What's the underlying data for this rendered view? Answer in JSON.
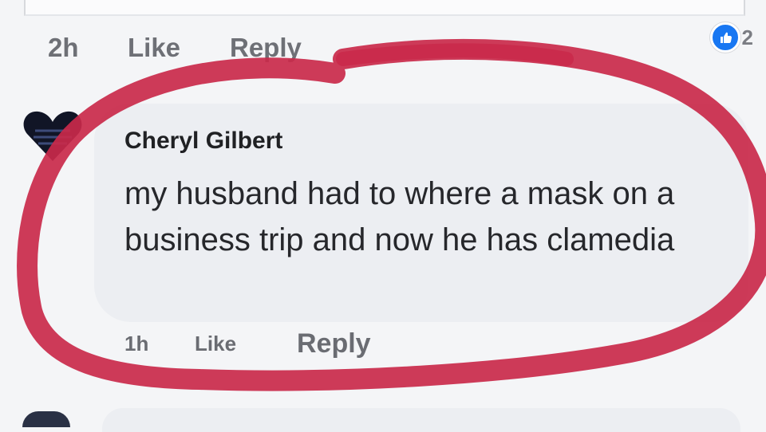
{
  "top_comment": {
    "time": "2h",
    "like_label": "Like",
    "reply_label": "Reply",
    "reaction_count": "2",
    "reaction_icon": "thumbs-up-icon",
    "reaction_color": "#1877f2"
  },
  "comment": {
    "author": "Cheryl Gilbert",
    "text": "my husband had to where a mask on a business trip and now he has clamedia",
    "time": "1h",
    "like_label": "Like",
    "reply_label": "Reply",
    "avatar_icon": "heart-avatar-icon"
  },
  "annotation": {
    "shape": "hand-drawn-circle",
    "color": "#c9294a"
  }
}
